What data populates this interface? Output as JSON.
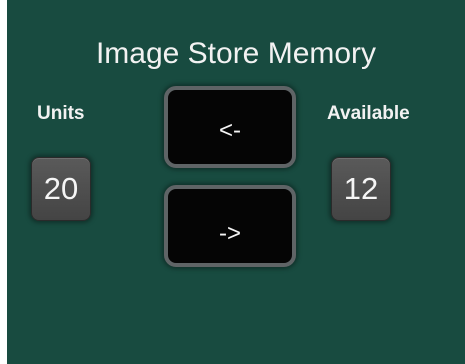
{
  "panel": {
    "title": "Image Store Memory",
    "units_label": "Units",
    "available_label": "Available",
    "units_value": "20",
    "available_value": "12",
    "left_button_label": "<-",
    "right_button_label": "->"
  },
  "colors": {
    "panel_background": "#184b40",
    "button_background": "#050505",
    "button_border": "#5f6466",
    "value_box_background": "#4e4e4e",
    "text": "#f2f2f2"
  }
}
